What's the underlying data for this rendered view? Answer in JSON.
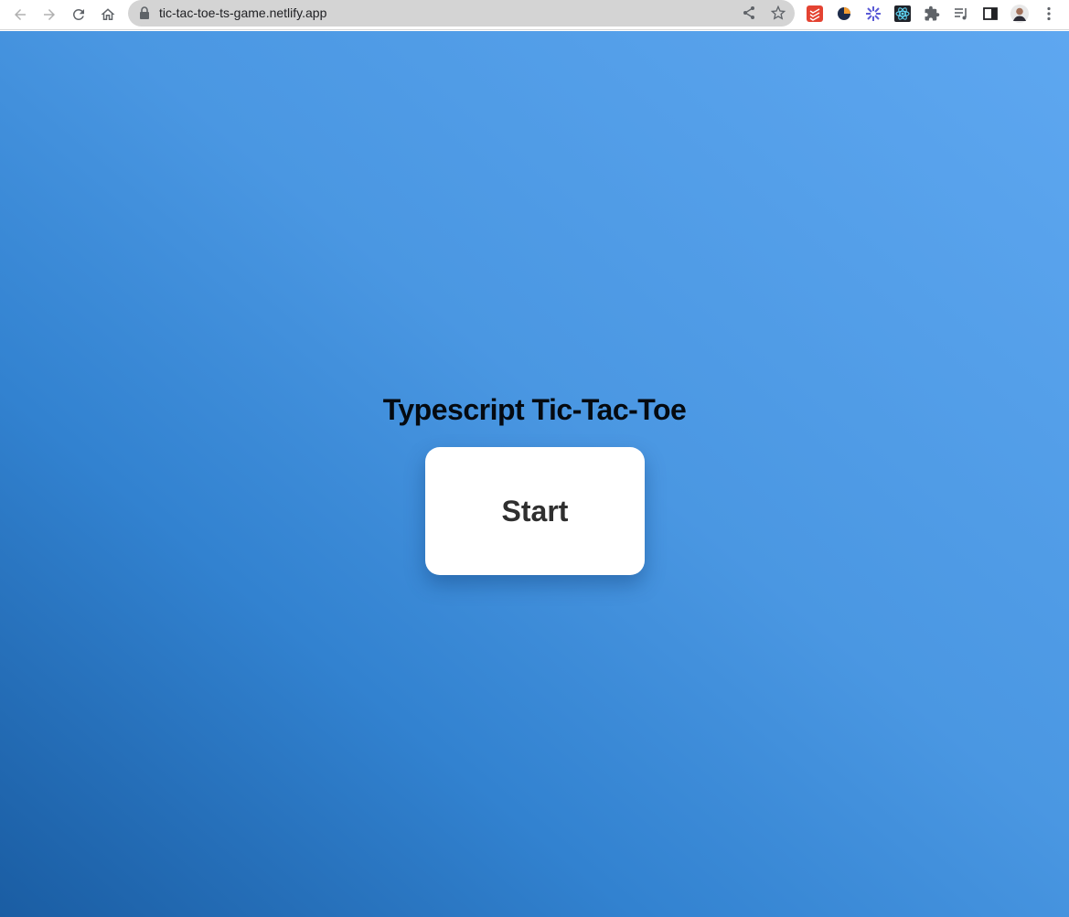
{
  "browser": {
    "url": "tic-tac-toe-ts-game.netlify.app",
    "nav": {
      "back_icon": "arrow-left-icon",
      "forward_icon": "arrow-right-icon",
      "reload_icon": "reload-icon",
      "home_icon": "home-icon"
    },
    "omnibox_icons": [
      "lock-icon",
      "share-icon",
      "star-icon"
    ],
    "extensions": [
      "todoist-extension-icon",
      "extension-round-icon",
      "gear-flower-extension-icon",
      "react-devtools-icon",
      "puzzle-icon",
      "reading-list-icon",
      "side-panel-icon",
      "profile-avatar",
      "kebab-menu-icon"
    ]
  },
  "page": {
    "title": "Typescript Tic-Tac-Toe",
    "start_label": "Start"
  },
  "colors": {
    "gradient_start": "#1a5da3",
    "gradient_end": "#5ea7f0",
    "button_bg": "#ffffff",
    "button_text": "#2f2f2f",
    "title_text": "#050a10"
  }
}
